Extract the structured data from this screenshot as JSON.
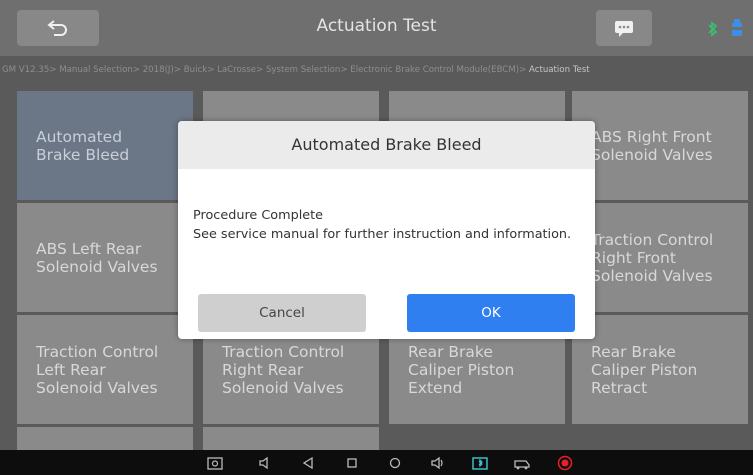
{
  "header": {
    "title": "Actuation Test"
  },
  "breadcrumb": {
    "path": "GM V12.35> Manual Selection> 2018(J)> Buick> LaCrosse> System Selection> Electronic Brake Control Module(EBCM)> ",
    "current": "Actuation Test"
  },
  "tiles": [
    {
      "line1": "Automated",
      "line2": "Brake Bleed",
      "line3": ""
    },
    {
      "line1": "",
      "line2": "",
      "line3": ""
    },
    {
      "line1": "",
      "line2": "",
      "line3": ""
    },
    {
      "line1": "ABS Right Front",
      "line2": "Solenoid Valves",
      "line3": ""
    },
    {
      "line1": "ABS Left Rear",
      "line2": "Solenoid Valves",
      "line3": ""
    },
    {
      "line1": "",
      "line2": "",
      "line3": ""
    },
    {
      "line1": "",
      "line2": "",
      "line3": ""
    },
    {
      "line1": "Traction Control",
      "line2": "Right Front",
      "line3": "Solenoid Valves"
    },
    {
      "line1": "Traction Control",
      "line2": "Left Rear",
      "line3": "Solenoid Valves"
    },
    {
      "line1": "Traction Control",
      "line2": "Right Rear",
      "line3": "Solenoid Valves"
    },
    {
      "line1": "Rear Brake",
      "line2": "Caliper Piston",
      "line3": "Extend"
    },
    {
      "line1": "Rear Brake",
      "line2": "Caliper Piston",
      "line3": "Retract"
    },
    {
      "line1": "",
      "line2": "",
      "line3": ""
    },
    {
      "line1": "",
      "line2": "",
      "line3": ""
    }
  ],
  "dialog": {
    "title": "Automated Brake Bleed",
    "line1": "Procedure Complete",
    "line2": "See service manual for further instruction and information.",
    "cancel_label": "Cancel",
    "ok_label": "OK"
  },
  "colors": {
    "accent": "#2f7ff0",
    "record": "#e8202a",
    "bluetooth": "#37c36b",
    "battery": "#3e8ee8"
  }
}
